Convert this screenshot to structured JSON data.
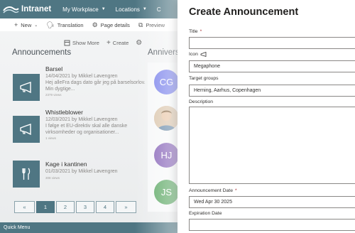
{
  "topnav": {
    "brand": "Intranet",
    "items": [
      {
        "label": "My Workplace"
      },
      {
        "label": "Locations"
      },
      {
        "label": "C"
      }
    ]
  },
  "cmdbar": {
    "new_label": "New",
    "translation_label": "Translation",
    "page_details_label": "Page details",
    "preview_label": "Preview"
  },
  "webpart_tools": {
    "show_more": "Show More",
    "create": "Create"
  },
  "announcements": {
    "section_title": "Announcements",
    "items": [
      {
        "icon": "megaphone-icon",
        "title": "Barsel",
        "meta": "14/04/2021 by Mikkel Løvengren",
        "desc": "Hej alleFra dags dato går jeg på barselsorlov. Min dygtige...",
        "views": "2379 views"
      },
      {
        "icon": "megaphone-icon",
        "title": "Whistleblower",
        "meta": "12/03/2021 by Mikkel Løvengren",
        "desc": "I følge et EU-direktiv skal alle danske virksomheder og organisationer...",
        "views": "1 views"
      },
      {
        "icon": "fork-knife-icon",
        "title": "Kage i kantinen",
        "meta": "01/03/2021 by Mikkel Løvengren",
        "desc": "",
        "views": "308 views"
      }
    ]
  },
  "anniversaries": {
    "section_title": "Anniversaries",
    "avatars": [
      {
        "initials": "CG",
        "color": "#7b83eb"
      },
      {
        "initials": "",
        "color": "#c9a98a"
      },
      {
        "initials": "HJ",
        "color": "#8764b8"
      },
      {
        "initials": "JS",
        "color": "#5da865"
      }
    ]
  },
  "pager": {
    "prev": "«",
    "pages": [
      "1",
      "2",
      "3",
      "4"
    ],
    "next": "»",
    "active": "1"
  },
  "quick_menu": "Quick Menu",
  "panel": {
    "title": "Create Announcement",
    "title_label": "Title",
    "title_value": "",
    "icon_label": "Icon",
    "icon_value": "Megaphone",
    "target_groups_label": "Target groups",
    "target_groups_value": "Herning, Aarhus, Copenhagen",
    "description_label": "Description",
    "announcement_date_label": "Announcement Date",
    "announcement_date_value": "Wed Apr 30 2025",
    "expiration_date_label": "Expiration Date",
    "expiration_date_value": "",
    "required_marker": "*"
  },
  "colors": {
    "accent": "#4f7683",
    "required": "#a4262c"
  }
}
